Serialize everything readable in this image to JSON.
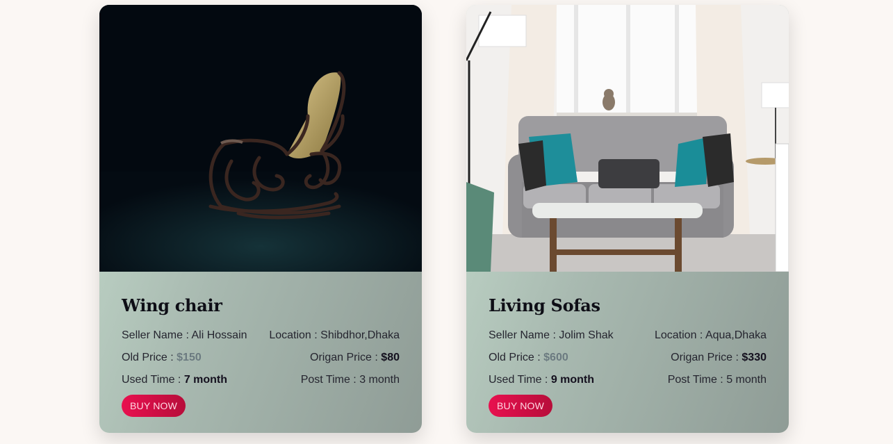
{
  "products": [
    {
      "image_alt": "rocking-chair-photo",
      "title": "Wing chair",
      "seller_label": "Seller Name : ",
      "seller": "Ali Hossain",
      "location_label": "Location : ",
      "location": "Shibdhor,Dhaka",
      "old_price_label": "Old Price : ",
      "old_price": "$150",
      "origin_price_label": "Origan Price : ",
      "origin_price": "$80",
      "used_label": "Used Time : ",
      "used": "7 month",
      "post_label": "Post Time : ",
      "post": "3 month",
      "button": "BUY NOW"
    },
    {
      "image_alt": "living-room-sofa-photo",
      "title": "Living Sofas",
      "seller_label": "Seller Name : ",
      "seller": "Jolim Shak",
      "location_label": "Location : ",
      "location": "Aqua,Dhaka",
      "old_price_label": "Old Price : ",
      "old_price": "$600",
      "origin_price_label": "Origan Price : ",
      "origin_price": "$330",
      "used_label": "Used Time : ",
      "used": "9 month",
      "post_label": "Post Time : ",
      "post": "5 month",
      "button": "BUY NOW"
    }
  ],
  "colors": {
    "button_start": "#e8104f",
    "button_end": "#b70d3a",
    "card_gradient_start": "#c5dccd",
    "card_gradient_end": "#8f9c96",
    "page_bg": "#fbf7f4"
  }
}
